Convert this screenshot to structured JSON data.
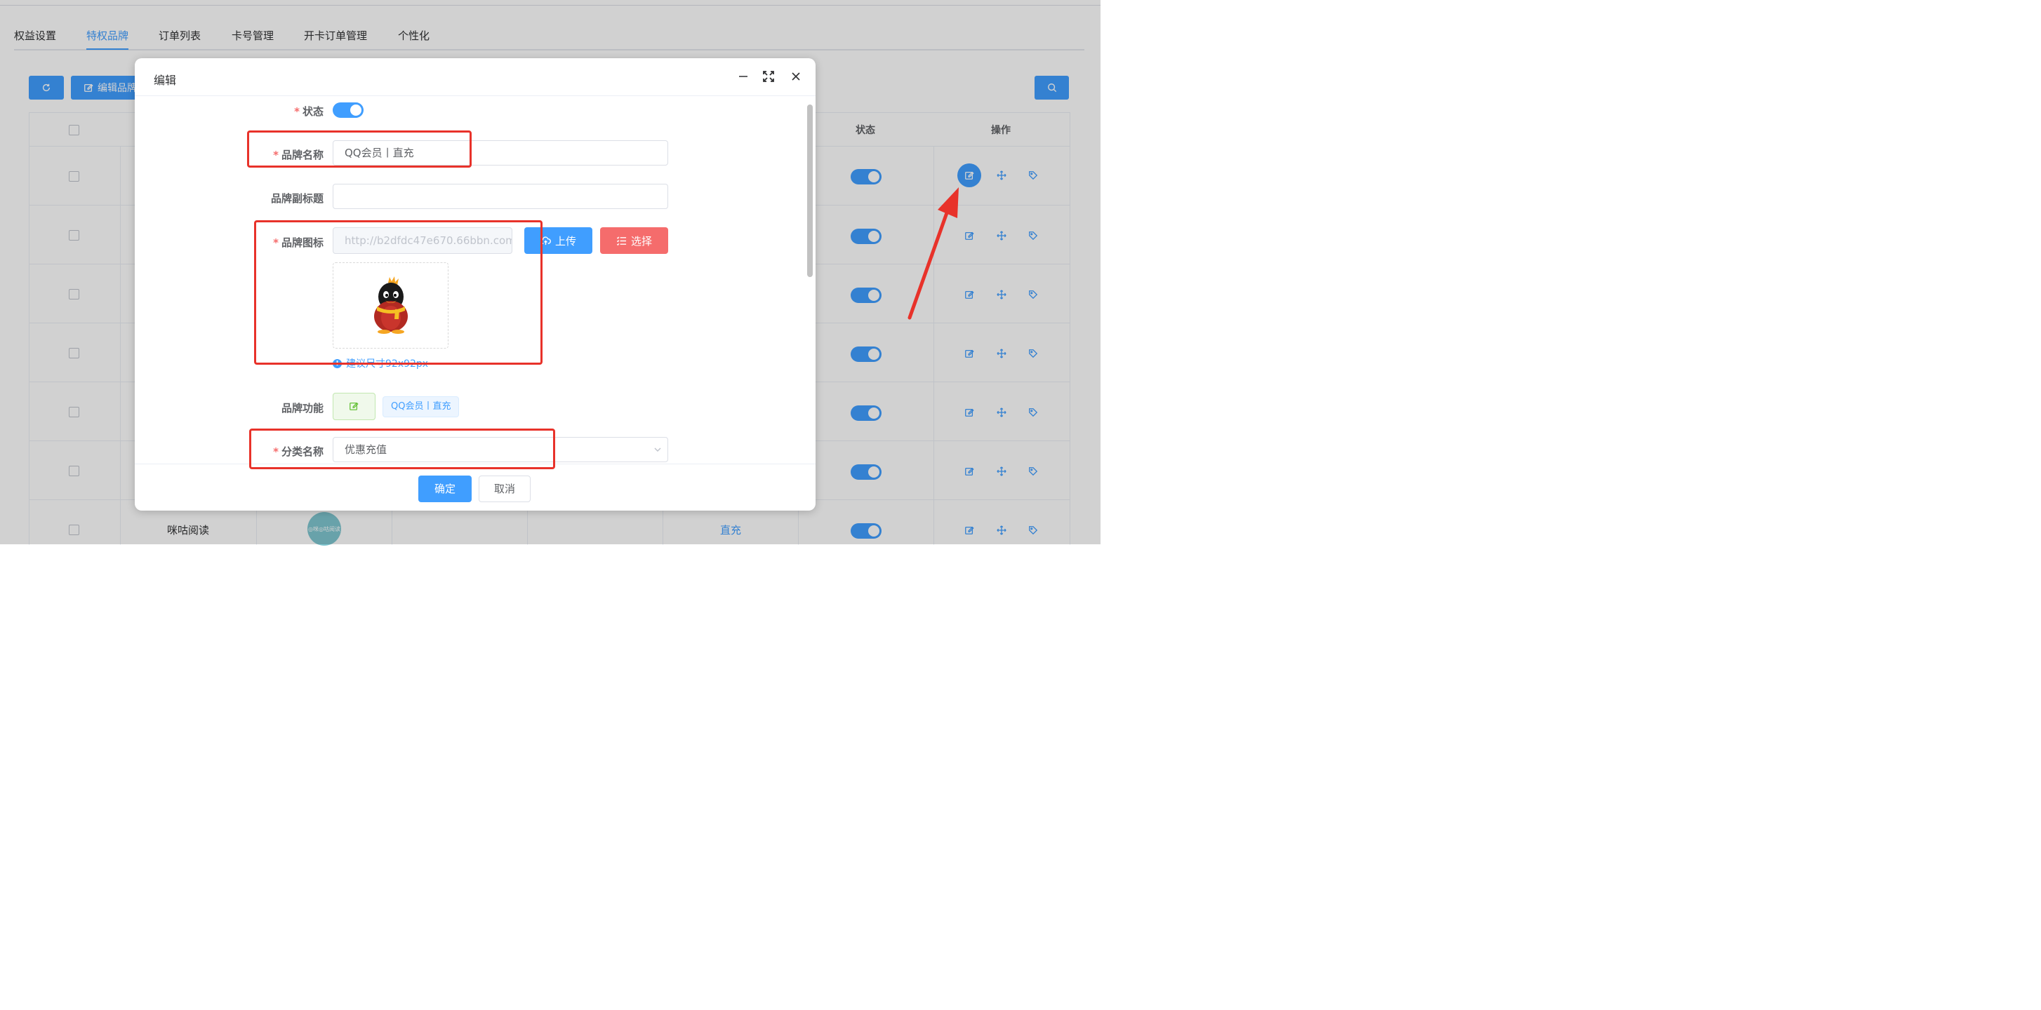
{
  "tabs": [
    "权益设置",
    "特权品牌",
    "订单列表",
    "卡号管理",
    "开卡订单管理",
    "个性化"
  ],
  "active_tab": "特权品牌",
  "toolbar": {
    "edit_brand_label": "编辑品牌"
  },
  "table": {
    "headers": {
      "status": "状态",
      "actions": "操作"
    },
    "last_row": {
      "name": "咪咕阅读",
      "logo_text": "◎咪◎咕阅读",
      "type": "直充"
    }
  },
  "dialog": {
    "title": "编辑",
    "fields": {
      "status_label": "状态",
      "brand_name_label": "品牌名称",
      "brand_name_value": "QQ会员丨直充",
      "subtitle_label": "品牌副标题",
      "subtitle_value": "",
      "icon_label": "品牌图标",
      "icon_url": "http://b2dfdc47e670.66bbn.com",
      "upload_label": "上传",
      "select_label": "选择",
      "icon_hint": "建议尺寸92x92px",
      "function_label": "品牌功能",
      "function_tag": "QQ会员丨直充",
      "category_label": "分类名称",
      "category_value": "优惠充值"
    },
    "confirm_label": "确定",
    "cancel_label": "取消"
  },
  "colors": {
    "primary": "#409eff",
    "danger": "#f56c6c",
    "annotation_red": "#e8322a"
  }
}
